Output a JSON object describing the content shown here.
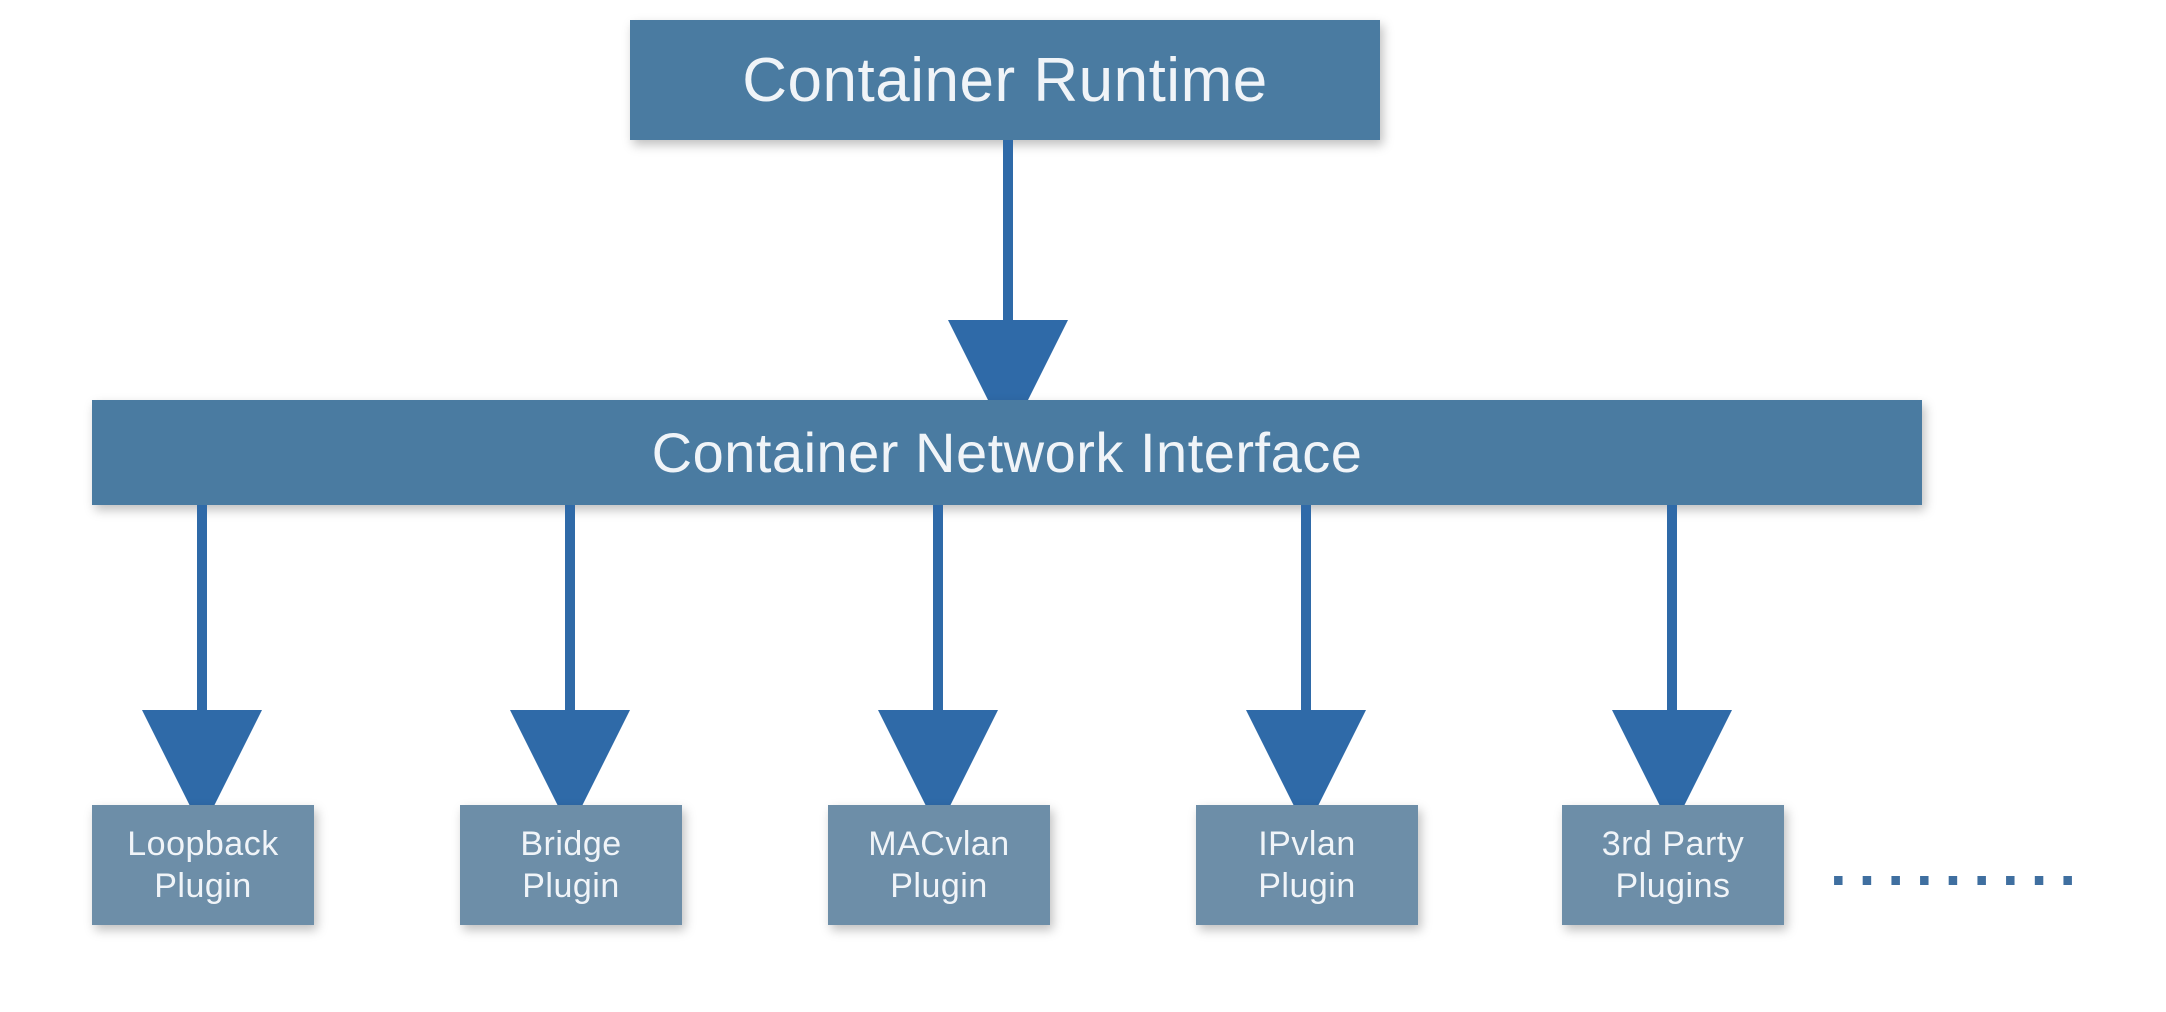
{
  "colors": {
    "box_dark": "#4a7ba1",
    "box_light": "#6d8ea8",
    "arrow": "#2f6aa8",
    "dots": "#3f6fa0"
  },
  "top": {
    "label": "Container Runtime"
  },
  "mid": {
    "label": "Container Network Interface"
  },
  "plugins": [
    {
      "label": "Loopback\nPlugin"
    },
    {
      "label": "Bridge\nPlugin"
    },
    {
      "label": "MACvlan\nPlugin"
    },
    {
      "label": "IPvlan\nPlugin"
    },
    {
      "label": "3rd Party\nPlugins"
    }
  ],
  "ellipsis": "........."
}
